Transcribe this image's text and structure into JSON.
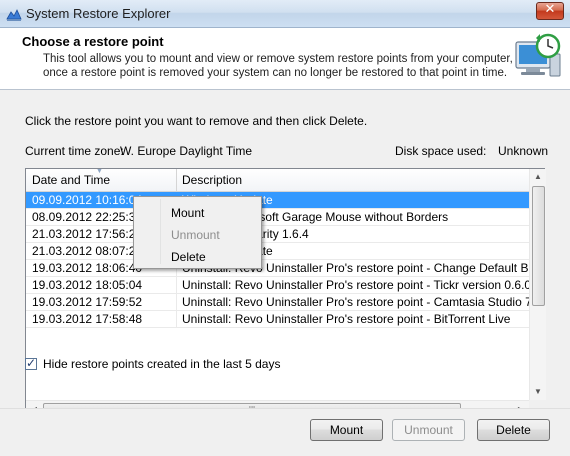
{
  "window": {
    "title": "System Restore Explorer",
    "close_glyph": "✕"
  },
  "header": {
    "title": "Choose a restore point",
    "description": "This tool allows you to mount and view or remove system restore points from your computer, once a restore point is removed your system can no longer be restored to that point in time."
  },
  "instruction": "Click the restore point you want to remove and then click Delete.",
  "timezone": {
    "label": "Current time zone:",
    "value": "W. Europe Daylight Time"
  },
  "disk_space": {
    "label": "Disk space used:",
    "value": "Unknown"
  },
  "list": {
    "columns": {
      "date": "Date and Time",
      "description": "Description"
    },
    "rows": [
      {
        "date": "09.09.2012 10:16:04",
        "description": "Windows Update"
      },
      {
        "date": "08.09.2012 22:25:37",
        "description": "Installed Microsoft Garage Mouse without Borders"
      },
      {
        "date": "21.03.2012 17:56:20",
        "description": "Installed Similarity 1.6.4"
      },
      {
        "date": "21.03.2012 08:07:22",
        "description": "Windows Update"
      },
      {
        "date": "19.03.2012 18:06:40",
        "description": "Uninstall: Revo Uninstaller Pro's restore point - Change Default Browser"
      },
      {
        "date": "19.03.2012 18:05:04",
        "description": "Uninstall: Revo Uninstaller Pro's restore point - Tickr version 0.6.0"
      },
      {
        "date": "19.03.2012 17:59:52",
        "description": "Uninstall: Revo Uninstaller Pro's restore point - Camtasia Studio 7"
      },
      {
        "date": "19.03.2012 17:58:48",
        "description": "Uninstall: Revo Uninstaller Pro's restore point - BitTorrent Live"
      }
    ],
    "selected_index": 0
  },
  "context_menu": {
    "mount": "Mount",
    "unmount": "Unmount",
    "delete": "Delete"
  },
  "hide_recent": {
    "label": "Hide restore points created in the last 5 days",
    "checked": true
  },
  "buttons": {
    "mount": "Mount",
    "unmount": "Unmount",
    "delete": "Delete"
  },
  "colors": {
    "selection": "#3399ff",
    "accent": "#1e6fbf"
  },
  "icons": {
    "app": "restore-app-icon",
    "header": "computer-clock-icon"
  }
}
